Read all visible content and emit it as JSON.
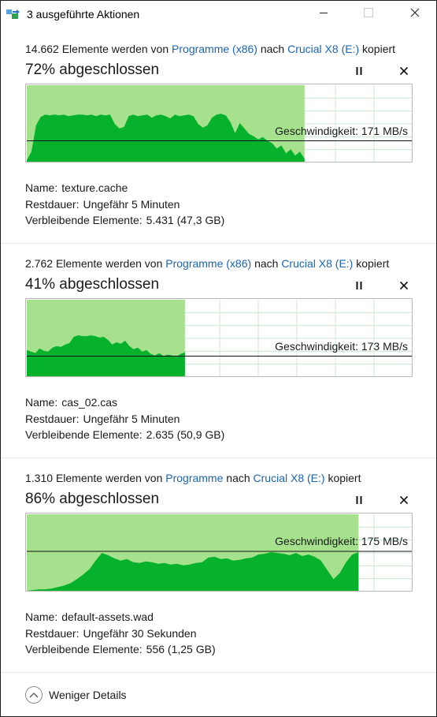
{
  "window": {
    "title": "3 ausgeführte Aktionen",
    "colors": {
      "accent_link": "#1a64b4",
      "fill_light": "#a6e28e",
      "fill_dark": "#06b22c",
      "grid": "#c9ead0"
    }
  },
  "operations": [
    {
      "count": "14.662",
      "text_mid": "Elemente werden von",
      "source": "Programme (x86)",
      "text_nach": "nach",
      "target": "Crucial X8 (E:)",
      "text_end": "kopiert",
      "percent_text": "72% abgeschlossen",
      "progress": 0.72,
      "speed_text": "Geschwindigkeit: 171 MB/s",
      "speed_line_level": 0.28,
      "name_label": "Name:",
      "name": "texture.cache",
      "rest_label": "Restdauer:",
      "rest": "Ungefähr 5 Minuten",
      "items_label": "Verbleibende Elemente:",
      "items": "5.431 (47,3 GB)",
      "throughput": [
        0.03,
        0.14,
        0.48,
        0.59,
        0.62,
        0.61,
        0.62,
        0.61,
        0.62,
        0.6,
        0.61,
        0.62,
        0.62,
        0.61,
        0.62,
        0.6,
        0.62,
        0.61,
        0.62,
        0.5,
        0.44,
        0.46,
        0.6,
        0.62,
        0.6,
        0.61,
        0.62,
        0.58,
        0.61,
        0.62,
        0.6,
        0.57,
        0.62,
        0.6,
        0.61,
        0.62,
        0.6,
        0.5,
        0.45,
        0.48,
        0.58,
        0.62,
        0.63,
        0.61,
        0.52,
        0.38,
        0.51,
        0.44,
        0.37,
        0.34,
        0.3,
        0.33,
        0.28,
        0.25,
        0.18,
        0.22,
        0.12,
        0.17,
        0.09,
        0.14,
        0.05
      ]
    },
    {
      "count": "2.762",
      "text_mid": "Elemente werden von",
      "source": "Programme (x86)",
      "text_nach": "nach",
      "target": "Crucial X8 (E:)",
      "text_end": "kopiert",
      "percent_text": "41% abgeschlossen",
      "progress": 0.41,
      "speed_text": "Geschwindigkeit: 173 MB/s",
      "speed_line_level": 0.27,
      "name_label": "Name:",
      "name": "cas_02.cas",
      "rest_label": "Restdauer:",
      "rest": "Ungefähr 5 Minuten",
      "items_label": "Verbleibende Elemente:",
      "items": "2.635 (50,9 GB)",
      "throughput": [
        0.35,
        0.33,
        0.31,
        0.37,
        0.34,
        0.33,
        0.38,
        0.4,
        0.39,
        0.42,
        0.44,
        0.52,
        0.54,
        0.53,
        0.53,
        0.54,
        0.53,
        0.51,
        0.52,
        0.48,
        0.42,
        0.45,
        0.43,
        0.47,
        0.4,
        0.36,
        0.38,
        0.33,
        0.35,
        0.3,
        0.28,
        0.31,
        0.27,
        0.29,
        0.28,
        0.26,
        0.3,
        0.32
      ]
    },
    {
      "count": "1.310",
      "text_mid": "Elemente werden von",
      "source": "Programme",
      "text_nach": "nach",
      "target": "Crucial X8 (E:)",
      "text_end": "kopiert",
      "percent_text": "86% abgeschlossen",
      "progress": 0.86,
      "speed_text": "Geschwindigkeit: 175 MB/s",
      "speed_line_level": 0.52,
      "name_label": "Name:",
      "name": "default-assets.wad",
      "rest_label": "Restdauer:",
      "rest": "Ungefähr 30 Sekunden",
      "items_label": "Verbleibende Elemente:",
      "items": "556 (1,25 GB)",
      "throughput": [
        0.01,
        0.02,
        0.03,
        0.03,
        0.04,
        0.06,
        0.08,
        0.11,
        0.16,
        0.22,
        0.29,
        0.4,
        0.5,
        0.47,
        0.43,
        0.4,
        0.42,
        0.38,
        0.37,
        0.39,
        0.38,
        0.36,
        0.37,
        0.35,
        0.36,
        0.34,
        0.35,
        0.37,
        0.38,
        0.44,
        0.45,
        0.42,
        0.43,
        0.4,
        0.41,
        0.43,
        0.44,
        0.48,
        0.49,
        0.51,
        0.5,
        0.49,
        0.47,
        0.5,
        0.46,
        0.48,
        0.45,
        0.4,
        0.28,
        0.16,
        0.24,
        0.38,
        0.48,
        0.51
      ]
    }
  ],
  "footer": {
    "label": "Weniger Details"
  }
}
